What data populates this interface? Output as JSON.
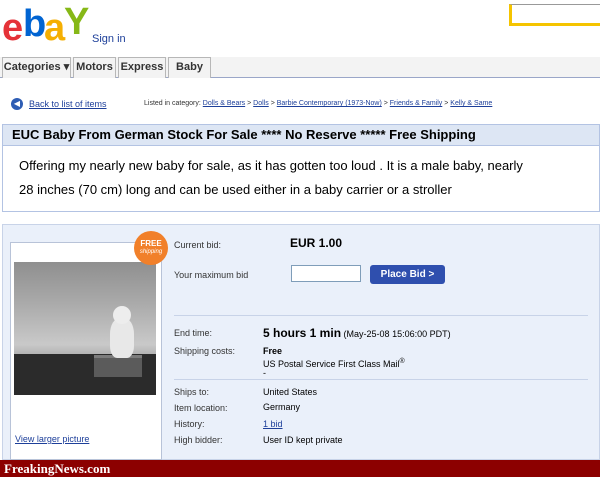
{
  "header": {
    "logo_letters": [
      "e",
      "b",
      "a",
      "Y"
    ],
    "logo_colors": [
      "#e53238",
      "#0064d2",
      "#f5af02",
      "#86b817"
    ],
    "signin_label": "Sign in"
  },
  "nav": {
    "tabs": [
      {
        "label": "Categories ▾"
      },
      {
        "label": "Motors"
      },
      {
        "label": "Express"
      },
      {
        "label": "Baby"
      }
    ]
  },
  "breadcrumb": {
    "back_label": "Back to list of items",
    "back_icon": "arrow-left-icon",
    "listed_prefix": "Listed in category:",
    "categories": [
      "Dolls & Bears",
      "Dolls",
      "Barbie Contemporary (1973-Now)",
      "Friends & Family",
      "Kelly & Same"
    ],
    "separator": ">"
  },
  "listing": {
    "title": "EUC Baby From German Stock For Sale ****  No Reserve ***** Free Shipping",
    "description_line1": "Offering my nearly new baby for sale, as it has gotten too loud . It is a male baby, nearly",
    "description_line2": "28 inches (70 cm) long and can be used either in a baby carrier or a stroller"
  },
  "item": {
    "free_badge": "FREE",
    "free_badge_sub": "shipping",
    "view_larger": "View larger picture",
    "current_bid_label": "Current bid:",
    "current_bid": "EUR 1.00",
    "max_bid_label": "Your maximum bid",
    "max_bid_value": "",
    "place_bid_label": "Place Bid >",
    "end_time_label": "End time:",
    "end_time_bold": "5 hours 1 min",
    "end_time_date": "(May-25-08 15:06:00 PDT)",
    "shipping_label": "Shipping costs:",
    "shipping_cost": "Free",
    "shipping_service": "US Postal Service First Class Mail",
    "shipping_reg": "®",
    "shipping_dash": "-",
    "ships_to_label": "Ships to:",
    "ships_to": "United States",
    "location_label": "Item location:",
    "location": "Germany",
    "history_label": "History:",
    "history": "1 bid",
    "high_bidder_label": "High bidder:",
    "high_bidder": "User ID kept private"
  },
  "footer": {
    "watermark": "FreakingNews.com"
  },
  "colors": {
    "link": "#1d3f9a",
    "title_bg": "#dde6f4",
    "panel_bg": "#eaf0fa",
    "bid_button": "#2f4fae",
    "footer_bg": "#8c0000",
    "badge": "#f1802a"
  }
}
